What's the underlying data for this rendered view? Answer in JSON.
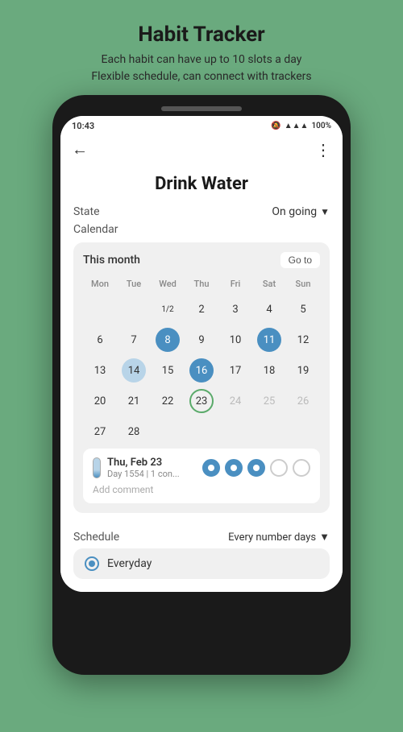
{
  "header": {
    "title": "Habit Tracker",
    "subtitle_line1": "Each habit can have up to 10 slots a day",
    "subtitle_line2": "Flexible schedule, can connect with trackers"
  },
  "status_bar": {
    "time": "10:43",
    "battery": "100%"
  },
  "habit": {
    "title": "Drink Water",
    "state_label": "State",
    "state_value": "On going",
    "calendar_label": "Calendar",
    "calendar_month": "This month",
    "goto_btn": "Go to",
    "day_headers": [
      "Mon",
      "Tue",
      "Wed",
      "Thu",
      "Fri",
      "Sat",
      "Sun"
    ],
    "week1": [
      {
        "num": "",
        "type": "empty"
      },
      {
        "num": "",
        "type": "empty"
      },
      {
        "num": "1/2",
        "type": "normal-small"
      },
      {
        "num": "2",
        "type": "normal"
      },
      {
        "num": "3",
        "type": "normal"
      },
      {
        "num": "4",
        "type": "normal"
      },
      {
        "num": "5",
        "type": "normal"
      }
    ],
    "week2": [
      {
        "num": "6",
        "type": "normal"
      },
      {
        "num": "7",
        "type": "normal"
      },
      {
        "num": "8",
        "type": "filled-dark"
      },
      {
        "num": "9",
        "type": "normal"
      },
      {
        "num": "10",
        "type": "normal"
      },
      {
        "num": "11",
        "type": "filled-dark"
      },
      {
        "num": "12",
        "type": "normal"
      }
    ],
    "week3": [
      {
        "num": "13",
        "type": "normal"
      },
      {
        "num": "14",
        "type": "filled-light"
      },
      {
        "num": "15",
        "type": "normal"
      },
      {
        "num": "16",
        "type": "filled-dark"
      },
      {
        "num": "17",
        "type": "normal"
      },
      {
        "num": "18",
        "type": "normal"
      },
      {
        "num": "19",
        "type": "normal"
      }
    ],
    "week4": [
      {
        "num": "20",
        "type": "normal"
      },
      {
        "num": "21",
        "type": "normal"
      },
      {
        "num": "22",
        "type": "normal"
      },
      {
        "num": "23",
        "type": "today"
      },
      {
        "num": "24",
        "type": "gray"
      },
      {
        "num": "25",
        "type": "gray"
      },
      {
        "num": "26",
        "type": "gray"
      }
    ],
    "week5": [
      {
        "num": "27",
        "type": "normal"
      },
      {
        "num": "28",
        "type": "normal"
      },
      {
        "num": "",
        "type": "empty"
      },
      {
        "num": "",
        "type": "empty"
      },
      {
        "num": "",
        "type": "empty"
      },
      {
        "num": "",
        "type": "empty"
      },
      {
        "num": "",
        "type": "empty"
      }
    ],
    "day_info_date": "Thu, Feb 23",
    "day_info_sub": "Day 1554 | 1 con...",
    "add_comment": "Add comment",
    "slots": [
      {
        "filled": true
      },
      {
        "filled": true
      },
      {
        "filled": true
      },
      {
        "filled": false
      },
      {
        "filled": false
      }
    ],
    "schedule_label": "Schedule",
    "schedule_value": "Every number days",
    "everyday_option": "Everyday"
  }
}
